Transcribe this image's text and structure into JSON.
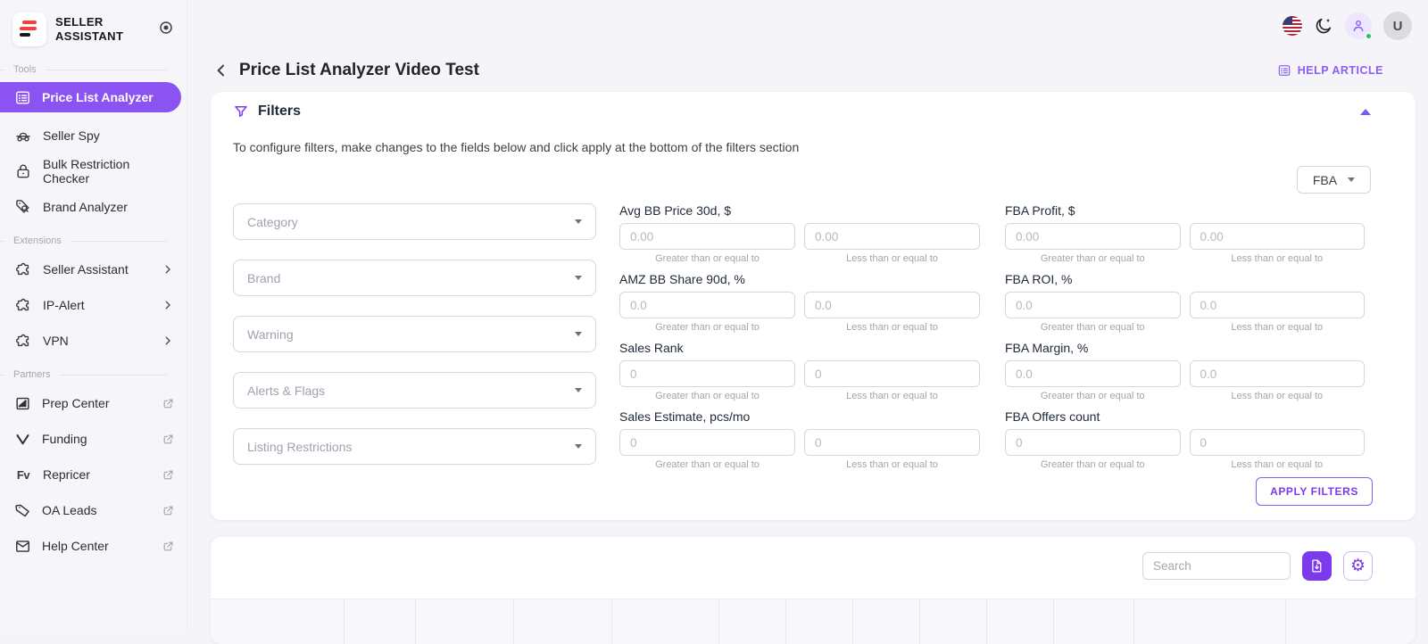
{
  "brand": {
    "line1": "SELLER",
    "line2": "ASSISTANT"
  },
  "sidebar": {
    "sections": [
      {
        "label": "Tools",
        "items": [
          {
            "label": "Price List Analyzer"
          },
          {
            "label": "Seller Spy"
          },
          {
            "label": "Bulk Restriction Checker"
          },
          {
            "label": "Brand Analyzer"
          }
        ]
      },
      {
        "label": "Extensions",
        "items": [
          {
            "label": "Seller Assistant"
          },
          {
            "label": "IP-Alert"
          },
          {
            "label": "VPN"
          }
        ]
      },
      {
        "label": "Partners",
        "items": [
          {
            "label": "Prep Center"
          },
          {
            "label": "Funding"
          },
          {
            "label": "Repricer"
          },
          {
            "label": "OA Leads"
          },
          {
            "label": "Help Center"
          }
        ]
      }
    ]
  },
  "header": {
    "title": "Price List Analyzer Video Test",
    "help_link": "HELP ARTICLE",
    "avatar_initial": "U"
  },
  "filters": {
    "title": "Filters",
    "description": "To configure filters, make changes to the fields below and click apply at the bottom of the filters section",
    "fulfillment_value": "FBA",
    "dropdowns": [
      {
        "placeholder": "Category"
      },
      {
        "placeholder": "Brand"
      },
      {
        "placeholder": "Warning"
      },
      {
        "placeholder": "Alerts & Flags"
      },
      {
        "placeholder": "Listing Restrictions"
      }
    ],
    "helper_gte": "Greater than or equal to",
    "helper_lte": "Less than or equal to",
    "mid_groups": [
      {
        "label": "Avg BB Price 30d, $",
        "ph": "0.00"
      },
      {
        "label": "AMZ BB Share 90d, %",
        "ph": "0.0"
      },
      {
        "label": "Sales Rank",
        "ph": "0"
      },
      {
        "label": "Sales Estimate, pcs/mo",
        "ph": "0"
      }
    ],
    "right_groups": [
      {
        "label": "FBA Profit, $",
        "ph": "0.00"
      },
      {
        "label": "FBA ROI, %",
        "ph": "0.0"
      },
      {
        "label": "FBA Margin, %",
        "ph": "0.0"
      },
      {
        "label": "FBA Offers count",
        "ph": "0"
      }
    ],
    "apply_label": "APPLY FILTERS"
  },
  "table_toolbar": {
    "search_placeholder": "Search"
  },
  "colors": {
    "accent": "#8B5CF6",
    "accent_dark": "#7C3AED",
    "active_nav_bg": "#8A53F2",
    "success_dot": "#22C55E"
  }
}
